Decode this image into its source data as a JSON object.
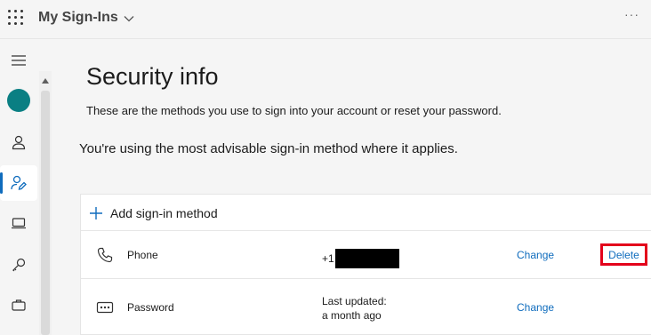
{
  "header": {
    "app_title": "My Sign-Ins",
    "more_label": "···"
  },
  "nav": {
    "items": [
      {
        "name": "menu",
        "icon": "hamburger-icon"
      },
      {
        "name": "overview",
        "icon": "avatar"
      },
      {
        "name": "security-info",
        "icon": "person-edit-icon",
        "active": true
      },
      {
        "name": "devices",
        "icon": "laptop-icon"
      },
      {
        "name": "password",
        "icon": "key-icon"
      },
      {
        "name": "organizations",
        "icon": "briefcase-icon"
      }
    ]
  },
  "main": {
    "title": "Security info",
    "description": "These are the methods you use to sign into your account or reset your password.",
    "advice": "You're using the most advisable sign-in method where it applies.",
    "add_method_label": "Add sign-in method",
    "methods": [
      {
        "name": "Phone",
        "detail_prefix": "+1",
        "detail_redacted": true,
        "change_label": "Change",
        "delete_label": "Delete"
      },
      {
        "name": "Password",
        "detail_line1": "Last updated:",
        "detail_line2": "a month ago",
        "change_label": "Change"
      }
    ]
  },
  "colors": {
    "accent": "#0f6cbd",
    "avatar": "#0a7f83",
    "highlight_border": "#e3001b"
  }
}
